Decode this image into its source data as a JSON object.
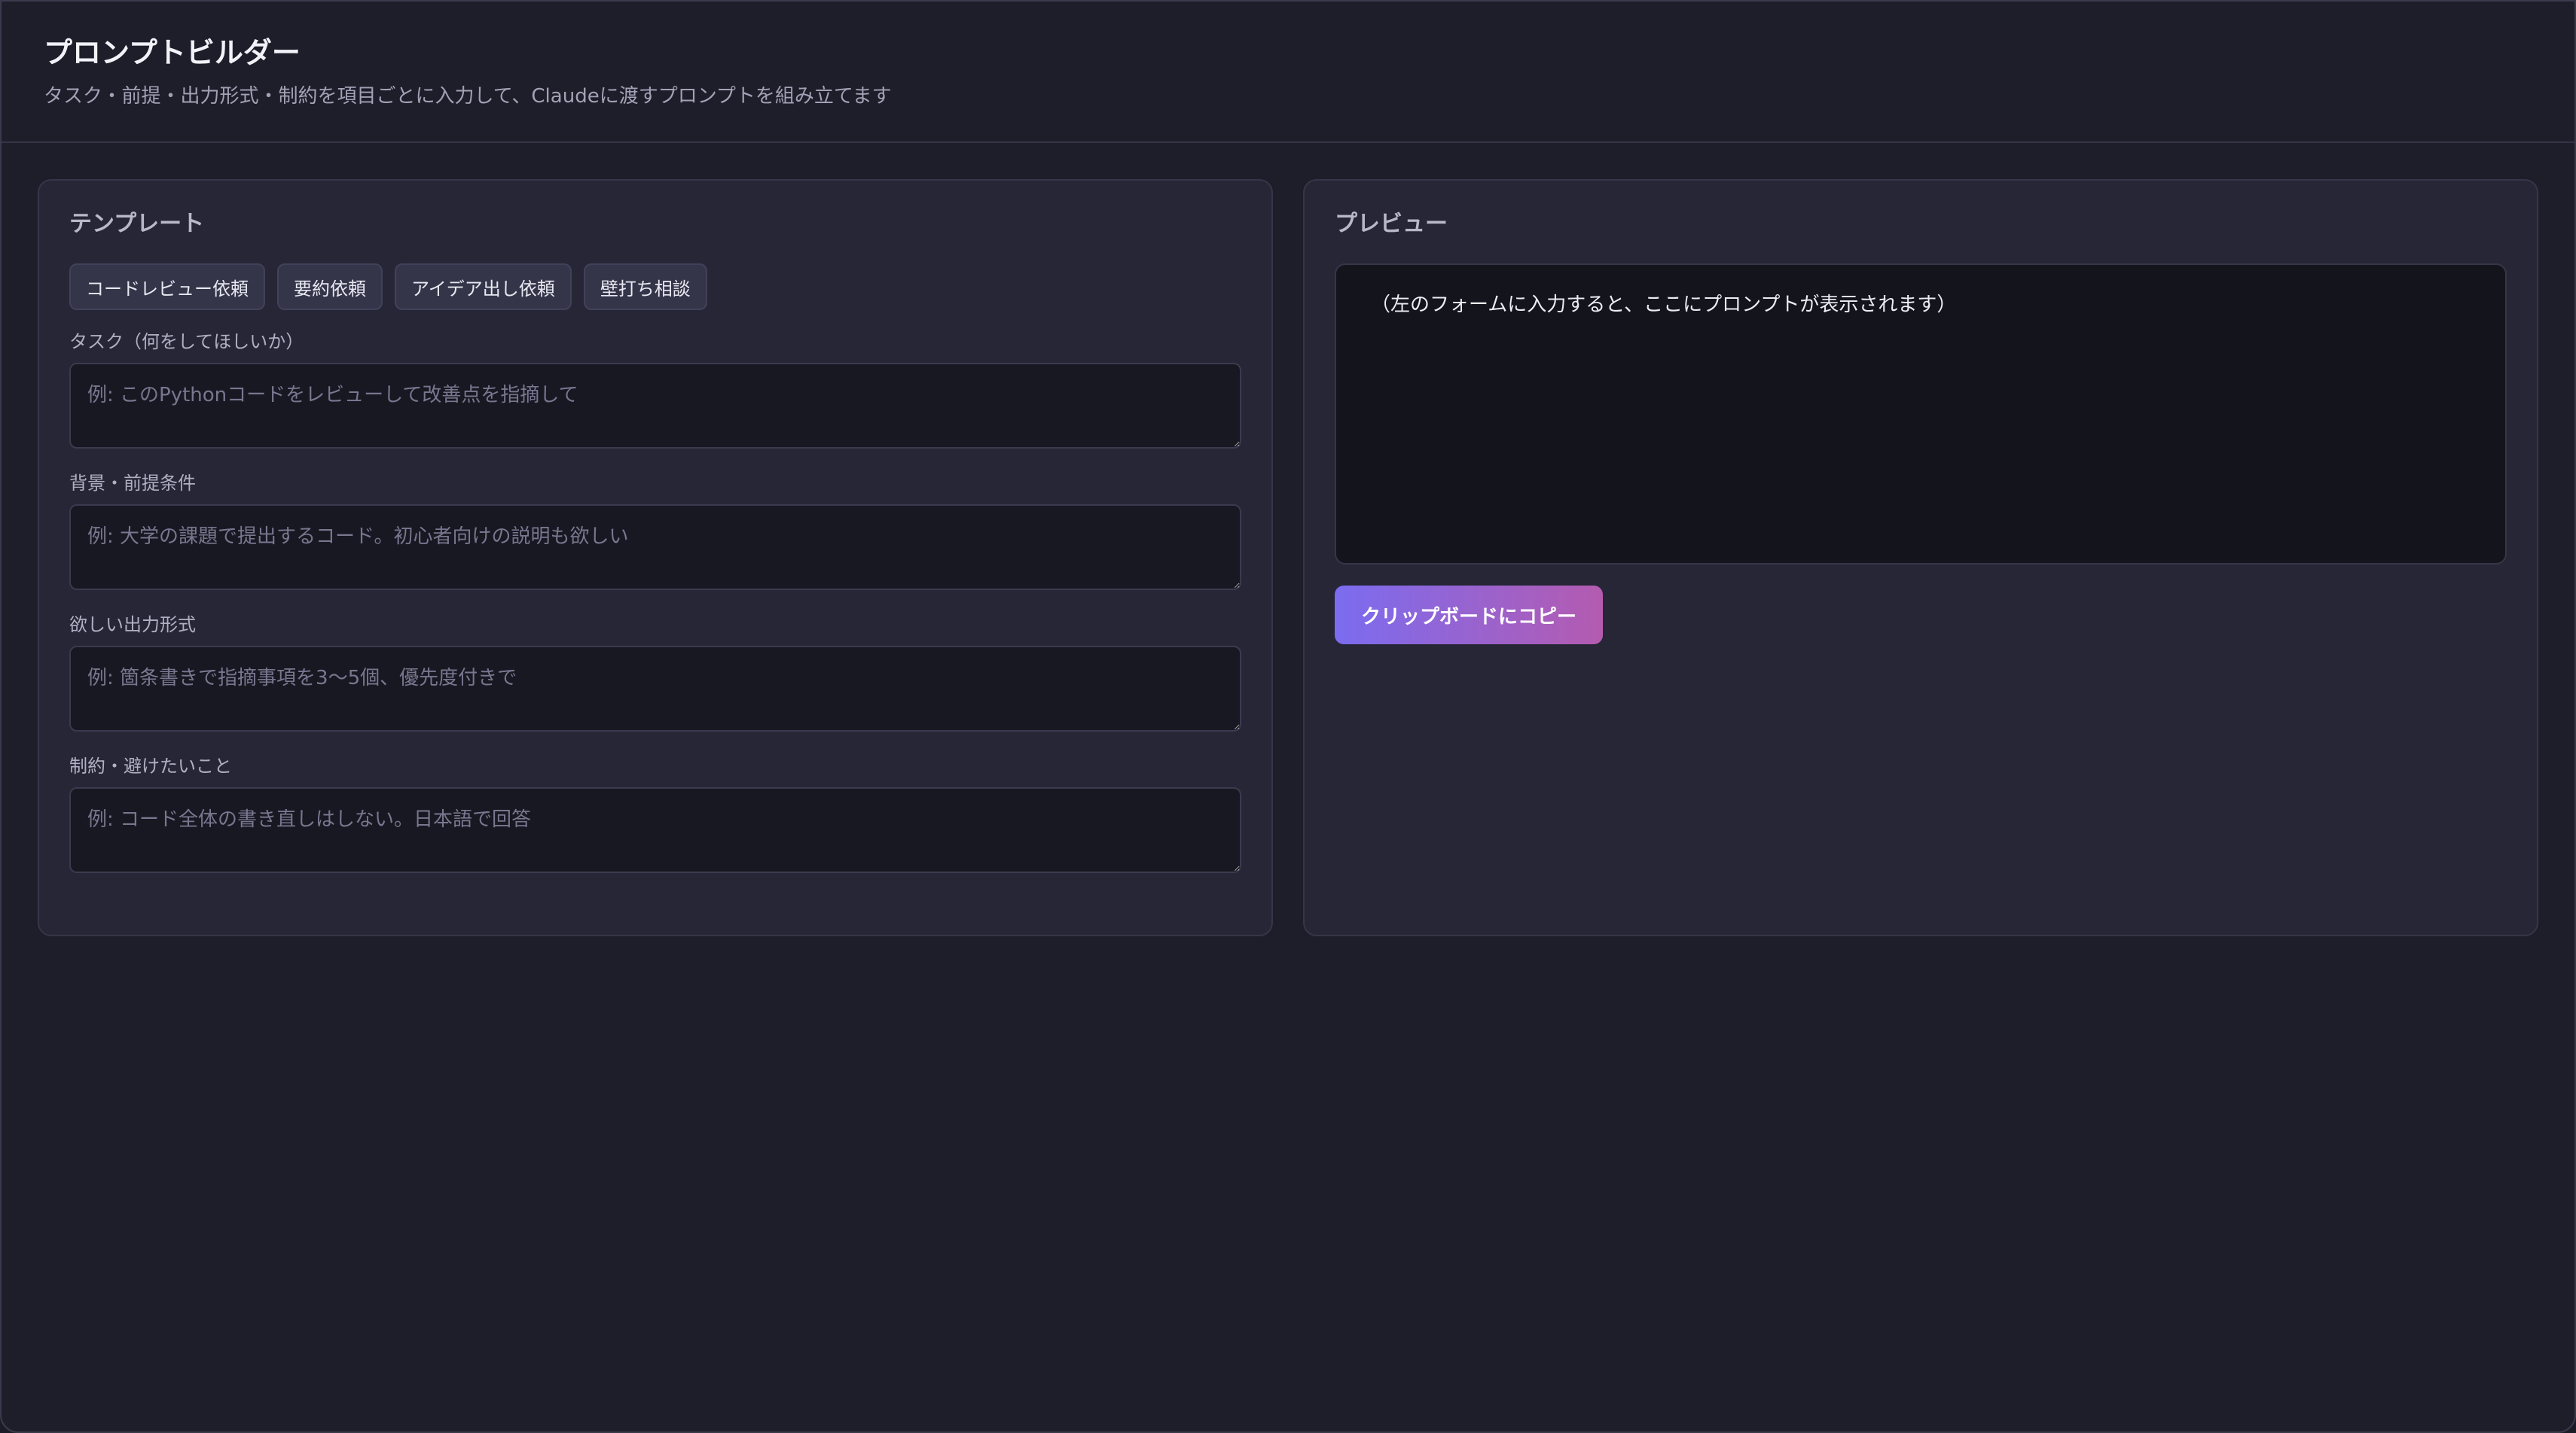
{
  "header": {
    "title": "プロンプトビルダー",
    "subtitle": "タスク・前提・出力形式・制約を項目ごとに入力して、Claudeに渡すプロンプトを組み立てます"
  },
  "templates": {
    "title": "テンプレート",
    "buttons": [
      "コードレビュー依頼",
      "要約依頼",
      "アイデア出し依頼",
      "壁打ち相談"
    ]
  },
  "fields": [
    {
      "label": "タスク（何をしてほしいか）",
      "placeholder": "例: このPythonコードをレビューして改善点を指摘して",
      "value": ""
    },
    {
      "label": "背景・前提条件",
      "placeholder": "例: 大学の課題で提出するコード。初心者向けの説明も欲しい",
      "value": ""
    },
    {
      "label": "欲しい出力形式",
      "placeholder": "例: 箇条書きで指摘事項を3〜5個、優先度付きで",
      "value": ""
    },
    {
      "label": "制約・避けたいこと",
      "placeholder": "例: コード全体の書き直しはしない。日本語で回答",
      "value": ""
    }
  ],
  "preview": {
    "title": "プレビュー",
    "text": "（左のフォームに入力すると、ここにプロンプトが表示されます）",
    "copy_label": "クリップボードにコピー"
  },
  "colors": {
    "background": "#1e1e2b",
    "panel": "#262636",
    "accent_start": "#7b6cf0",
    "accent_end": "#b45bb0"
  }
}
